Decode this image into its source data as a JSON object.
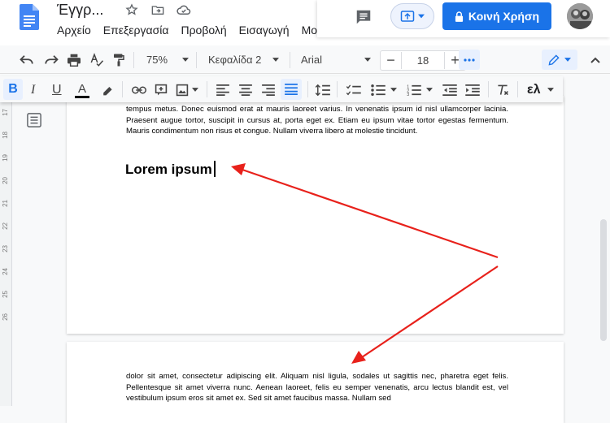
{
  "header": {
    "doc_title": "Έγγρ...",
    "menu": [
      "Αρχείο",
      "Επεξεργασία",
      "Προβολή",
      "Εισαγωγή",
      "Μο"
    ],
    "share_label": "Κοινή Χρήση"
  },
  "toolbar": {
    "zoom": "75%",
    "style": "Κεφαλίδα 2",
    "font": "Arial",
    "font_size": "18",
    "lang": "ελ"
  },
  "ruler": [
    "17",
    "18",
    "19",
    "20",
    "21",
    "22",
    "23",
    "24",
    "25",
    "26"
  ],
  "document": {
    "paragraph1": "tempus metus. Donec euismod erat at mauris laoreet varius. In venenatis ipsum id nisl ullamcorper lacinia. Praesent augue tortor, suscipit in cursus at, porta eget ex. Etiam eu ipsum vitae tortor egestas fermentum. Mauris condimentum non risus et congue. Nullam viverra libero at molestie tincidunt.",
    "heading": "Lorem ipsum",
    "paragraph2": "dolor sit amet, consectetur adipiscing elit. Aliquam nisl ligula, sodales ut sagittis nec, pharetra eget felis. Pellentesque sit amet viverra nunc. Aenean laoreet, felis eu semper venenatis, arcu lectus blandit est, vel vestibulum ipsum eros sit amet ex. Sed sit amet faucibus massa. Nullam sed"
  },
  "colors": {
    "accent": "#1a73e8",
    "annotation": "#e8211b"
  },
  "icons": [
    "docs-logo-icon",
    "star-icon",
    "move-folder-icon",
    "cloud-icon",
    "comments-icon",
    "present-icon",
    "lock-icon",
    "undo-icon",
    "redo-icon",
    "print-icon",
    "spellcheck-icon",
    "paint-format-icon",
    "bold-icon",
    "italic-icon",
    "underline-icon",
    "text-color-icon",
    "highlight-icon",
    "link-icon",
    "add-comment-icon",
    "image-icon",
    "align-left-icon",
    "align-center-icon",
    "align-right-icon",
    "justify-icon",
    "line-spacing-icon",
    "checklist-icon",
    "bulleted-list-icon",
    "numbered-list-icon",
    "decrease-indent-icon",
    "increase-indent-icon",
    "clear-format-icon",
    "edit-mode-icon",
    "outline-icon"
  ]
}
